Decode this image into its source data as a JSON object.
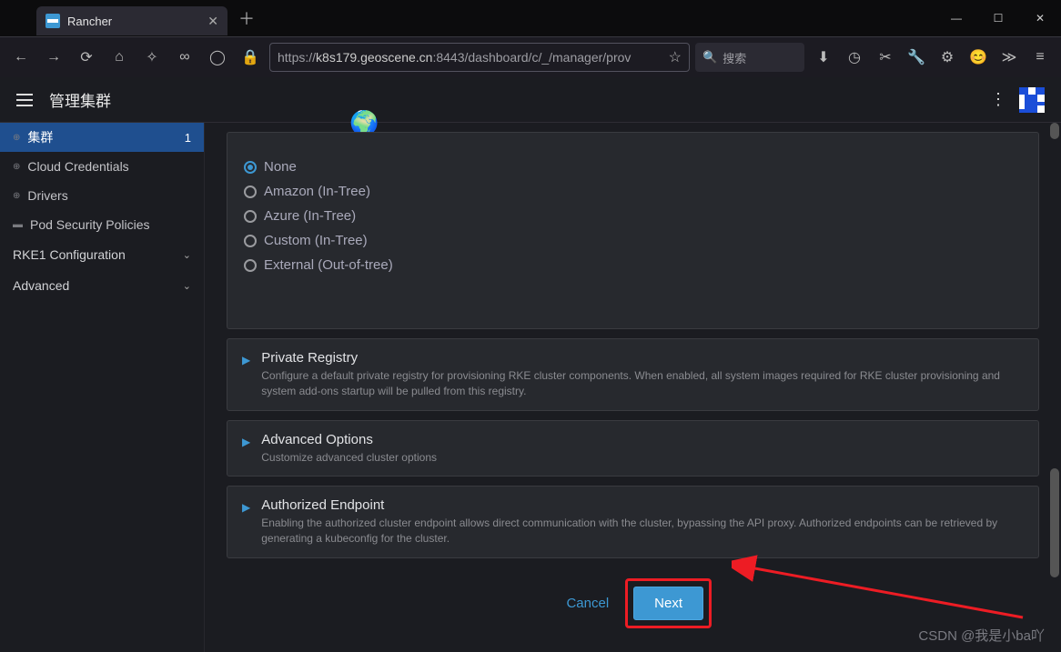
{
  "browser": {
    "tab_title": "Rancher",
    "url_prefix": "https://",
    "url_host": "k8s179.geoscene.cn",
    "url_rest": ":8443/dashboard/c/_/manager/prov",
    "search_placeholder": "搜索"
  },
  "header": {
    "title": "管理集群"
  },
  "sidebar": {
    "items": [
      {
        "label": "集群",
        "badge": "1",
        "active": true,
        "icon": "globe"
      },
      {
        "label": "Cloud Credentials",
        "icon": "globe"
      },
      {
        "label": "Drivers",
        "icon": "globe"
      },
      {
        "label": "Pod Security Policies",
        "icon": "folder"
      }
    ],
    "sections": [
      {
        "label": "RKE1 Configuration"
      },
      {
        "label": "Advanced"
      }
    ]
  },
  "provider": {
    "options": [
      {
        "label": "None",
        "checked": true
      },
      {
        "label": "Amazon (In-Tree)",
        "checked": false
      },
      {
        "label": "Azure (In-Tree)",
        "checked": false
      },
      {
        "label": "Custom (In-Tree)",
        "checked": false
      },
      {
        "label": "External (Out-of-tree)",
        "checked": false
      }
    ]
  },
  "panels": {
    "registry": {
      "title": "Private Registry",
      "desc": "Configure a default private registry for provisioning RKE cluster components. When enabled, all system images required for RKE cluster provisioning and system add-ons startup will be pulled from this registry."
    },
    "advanced": {
      "title": "Advanced Options",
      "desc": "Customize advanced cluster options"
    },
    "endpoint": {
      "title": "Authorized Endpoint",
      "desc": "Enabling the authorized cluster endpoint allows direct communication with the cluster, bypassing the API proxy. Authorized endpoints can be retrieved by generating a kubeconfig for the cluster."
    }
  },
  "footer": {
    "cancel": "Cancel",
    "next": "Next"
  },
  "watermark": "CSDN @我是小ba吖"
}
